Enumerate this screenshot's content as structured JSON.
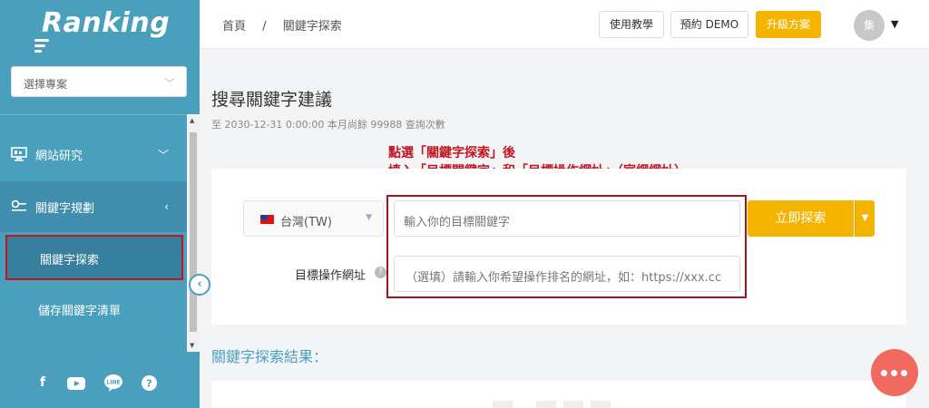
{
  "app": {
    "logo": "Ranking"
  },
  "sidebar": {
    "project_select": {
      "placeholder": "選擇專案"
    },
    "items": [
      {
        "label": "網站研究",
        "icon": "monitor-icon",
        "arrow": "﹀"
      },
      {
        "label": "關鍵字規劃",
        "icon": "key-icon",
        "arrow": "‹"
      }
    ],
    "sub_items": [
      {
        "label": "關鍵字探索",
        "active": true
      },
      {
        "label": "儲存關鍵字清單",
        "active": false
      }
    ],
    "social": [
      "facebook-icon",
      "youtube-icon",
      "line-icon",
      "help-icon"
    ]
  },
  "header": {
    "breadcrumb": [
      "首頁",
      "/",
      "關鍵字探索"
    ],
    "tutorial_label": "使用教學",
    "demo_label": "預約 DEMO",
    "upgrade_label": "升級方案",
    "avatar_text": "集"
  },
  "main": {
    "title": "搜尋關鍵字建議",
    "quota": "至 2030-12-31 0:00:00 本月尚餘 99988 查詢次數",
    "annotation_line1": "點選「關鍵字探索」後",
    "annotation_line2": "填入「目標關鍵字」和「目標操作網址」（官網網址）",
    "country": "台灣(TW)",
    "keyword_placeholder": "輸入你的目標關鍵字",
    "url_label": "目標操作網址",
    "url_placeholder": "（選填）請輸入你希望操作排名的網址，如：https://xxx.cc",
    "search_label": "立即探索",
    "results_title": "關鍵字探索結果："
  },
  "colors": {
    "sidebar": "#4a9fbd",
    "accent": "#f4b400",
    "annotation": "#c0141f"
  }
}
